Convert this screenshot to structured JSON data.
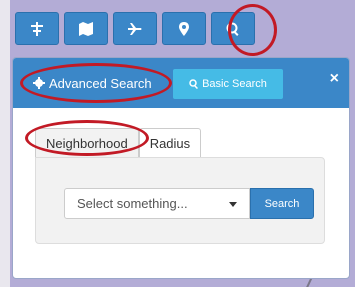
{
  "toolbar": {
    "buttons": [
      {
        "name": "filter-icon"
      },
      {
        "name": "map-icon"
      },
      {
        "name": "plane-icon"
      },
      {
        "name": "location-pin-icon"
      },
      {
        "name": "search-icon"
      }
    ]
  },
  "panel": {
    "tabs": {
      "advanced_label": "Advanced Search",
      "basic_label": "Basic Search"
    },
    "close_label": "×",
    "subtabs": {
      "neighborhood": "Neighborhood",
      "radius": "Radius"
    },
    "select": {
      "value": "Select something..."
    },
    "search_button": "Search"
  },
  "colors": {
    "primary": "#3b87c8",
    "info": "#45bbe6",
    "highlight_ring": "#c21a25",
    "background": "#b3acd6"
  }
}
